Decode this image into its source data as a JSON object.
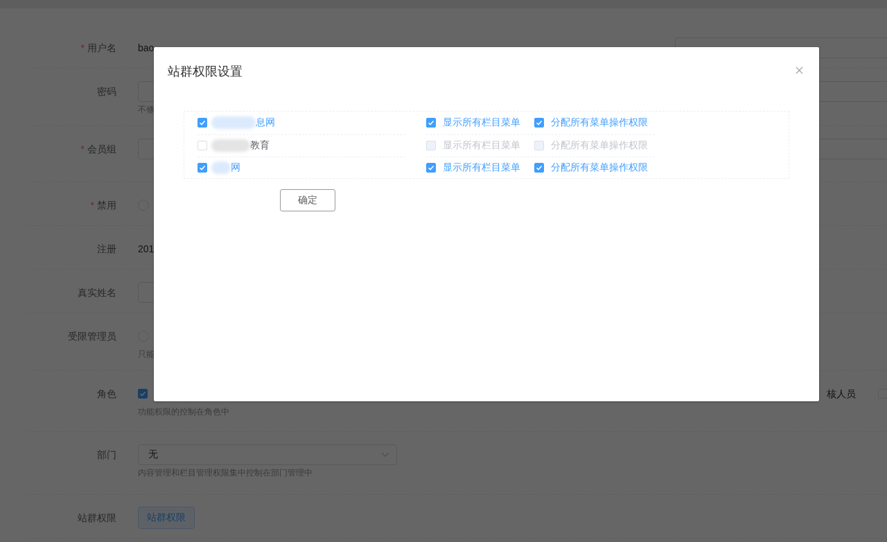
{
  "form": {
    "rows": [
      {
        "mark": "*",
        "label": "用户名",
        "kind": "text",
        "value": "bao",
        "side": {}
      },
      {
        "label": "密码",
        "kind": "input",
        "hint": "不修",
        "side": {}
      },
      {
        "mark": "*",
        "label": "会员组",
        "kind": "select",
        "side": {}
      },
      {
        "mark": "*",
        "label": "禁用",
        "kind": "radio",
        "selected": false
      },
      {
        "label": "注册",
        "kind": "text",
        "value": "201"
      },
      {
        "label": "真实姓名",
        "kind": "input"
      },
      {
        "label": "受限管理员",
        "kind": "radio",
        "selected": false,
        "hint": "只能"
      },
      {
        "label": "角色",
        "kind": "checkbox",
        "checked": true,
        "hint": "功能权限的控制在角色中",
        "extra": {
          "label": "核人员",
          "checked": false
        }
      },
      {
        "label": "部门",
        "kind": "select",
        "value": "无",
        "hint": "内容管理和栏目管理权限集中控制在部门管理中"
      },
      {
        "label": "站群权限",
        "kind": "button",
        "value": "站群权限"
      }
    ]
  },
  "dialog": {
    "title": "站群权限设置",
    "sites": [
      {
        "name": "息网",
        "checked": true,
        "options": [
          {
            "label": "显示所有栏目菜单",
            "checked": true,
            "disabled": false
          },
          {
            "label": "分配所有菜单操作权限",
            "checked": true,
            "disabled": false
          }
        ]
      },
      {
        "name": "教育",
        "checked": false,
        "options": [
          {
            "label": "显示所有栏目菜单",
            "checked": false,
            "disabled": true
          },
          {
            "label": "分配所有菜单操作权限",
            "checked": false,
            "disabled": true
          }
        ]
      },
      {
        "name": "网",
        "checked": true,
        "options": [
          {
            "label": "显示所有栏目菜单",
            "checked": true,
            "disabled": false
          },
          {
            "label": "分配所有菜单操作权限",
            "checked": true,
            "disabled": false
          }
        ]
      }
    ],
    "confirm": "确定"
  }
}
